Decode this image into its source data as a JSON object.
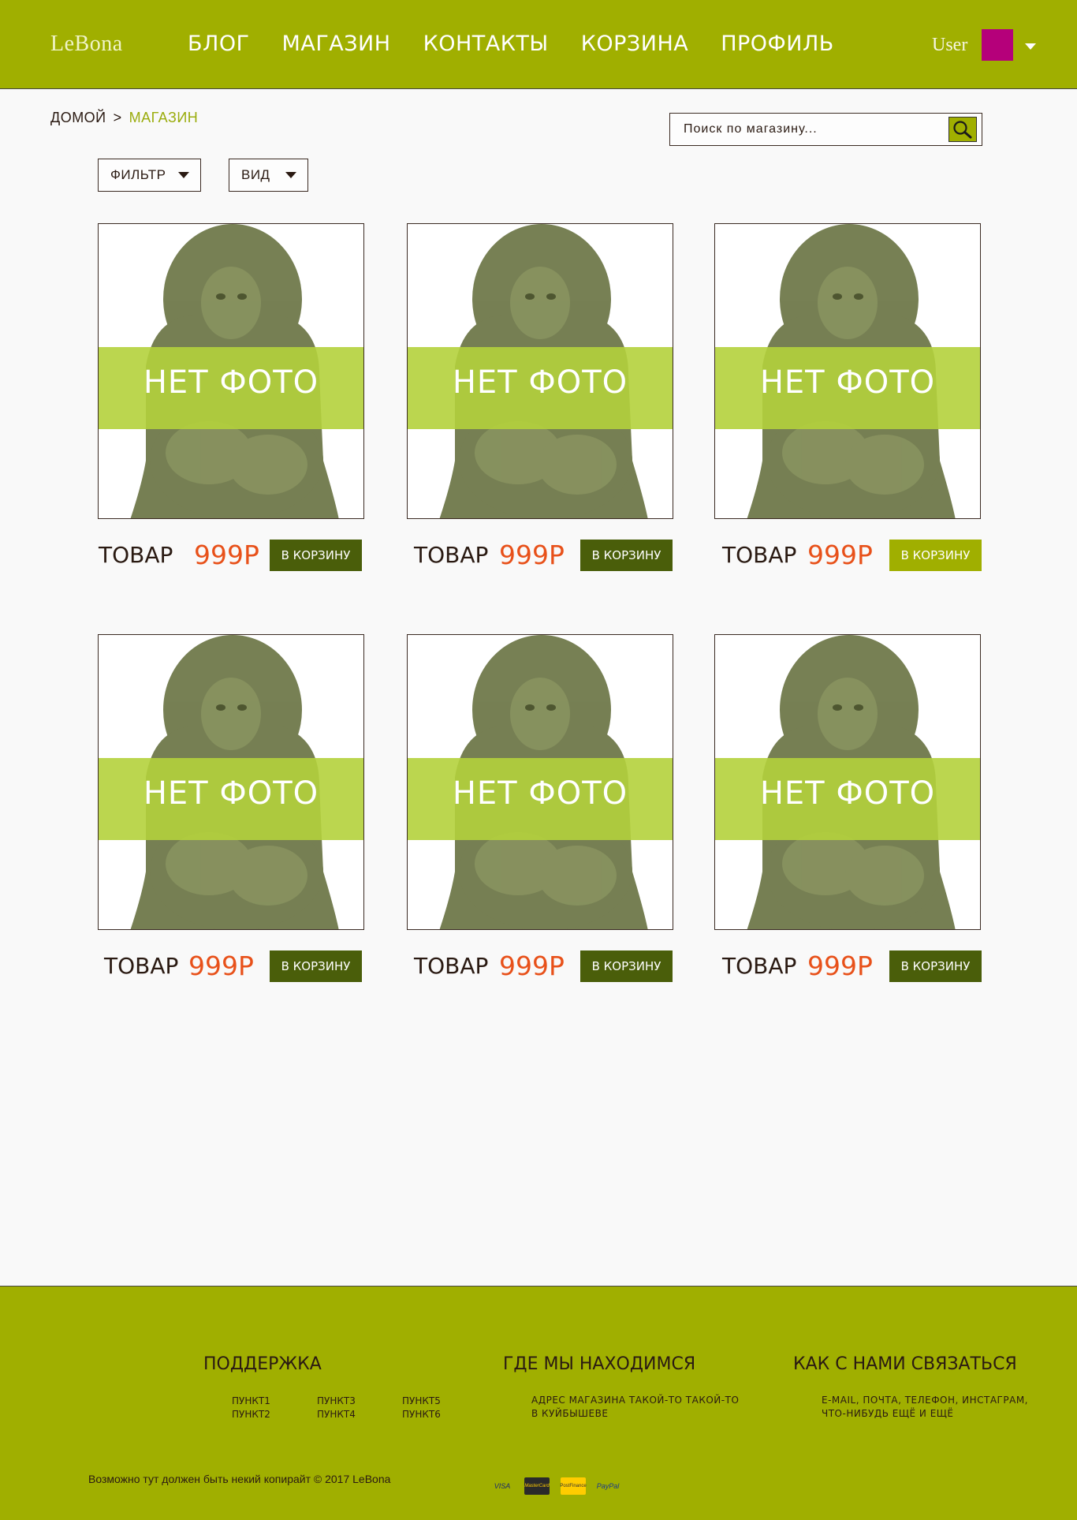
{
  "header": {
    "logo": "LeBona",
    "nav": [
      "БЛОГ",
      "МАГАЗИН",
      "КОНТАКТЫ",
      "КОРЗИНА",
      "ПРОФИЛЬ"
    ],
    "user_name": "User",
    "accent_color": "#a0af00",
    "avatar_color": "#b5007a"
  },
  "breadcrumb": {
    "home": "ДОМОЙ",
    "separator": ">",
    "current": "МАГАЗИН"
  },
  "search": {
    "placeholder": "Поиск по магазину...",
    "icon": "search-icon"
  },
  "filters": {
    "filter_label": "ФИЛЬТР",
    "view_label": "ВИД"
  },
  "products": [
    {
      "image_text": "НЕТ ФОТО",
      "name": "ТОВАР",
      "price": "999Р",
      "button": "В КОРЗИНУ",
      "active": false
    },
    {
      "image_text": "НЕТ ФОТО",
      "name": "ТОВАР",
      "price": "999Р",
      "button": "В КОРЗИНУ",
      "active": false
    },
    {
      "image_text": "НЕТ ФОТО",
      "name": "ТОВАР",
      "price": "999Р",
      "button": "В КОРЗИНУ",
      "active": true
    },
    {
      "image_text": "НЕТ ФОТО",
      "name": "ТОВАР",
      "price": "999Р",
      "button": "В КОРЗИНУ",
      "active": false
    },
    {
      "image_text": "НЕТ ФОТО",
      "name": "ТОВАР",
      "price": "999Р",
      "button": "В КОРЗИНУ",
      "active": false
    },
    {
      "image_text": "НЕТ ФОТО",
      "name": "ТОВАР",
      "price": "999Р",
      "button": "В КОРЗИНУ",
      "active": false
    }
  ],
  "footer": {
    "support": {
      "heading": "ПОДДЕРЖКА",
      "links": [
        "ПУНКТ1",
        "ПУНКТ2",
        "ПУНКТ3",
        "ПУНКТ4",
        "ПУНКТ5",
        "ПУНКТ6"
      ]
    },
    "location": {
      "heading": "ГДЕ МЫ НАХОДИМСЯ",
      "text_line1": "АДРЕС МАГАЗИНА ТАКОЙ-ТО ТАКОЙ-ТО",
      "text_line2": "В КУЙБЫШЕВЕ"
    },
    "contact": {
      "heading": "КАК С НАМИ СВЯЗАТЬСЯ",
      "text_line1": "E-MAIL, ПОЧТА, ТЕЛЕФОН, ИНСТАГРАМ,",
      "text_line2": "ЧТО-НИБУДЬ ЕЩЁ И ЕЩЁ"
    },
    "copyright": "Возможно тут должен быть некий копирайт © 2017 LeBona",
    "payments": [
      "VISA",
      "MasterCard",
      "PostFinance",
      "PayPal"
    ]
  }
}
